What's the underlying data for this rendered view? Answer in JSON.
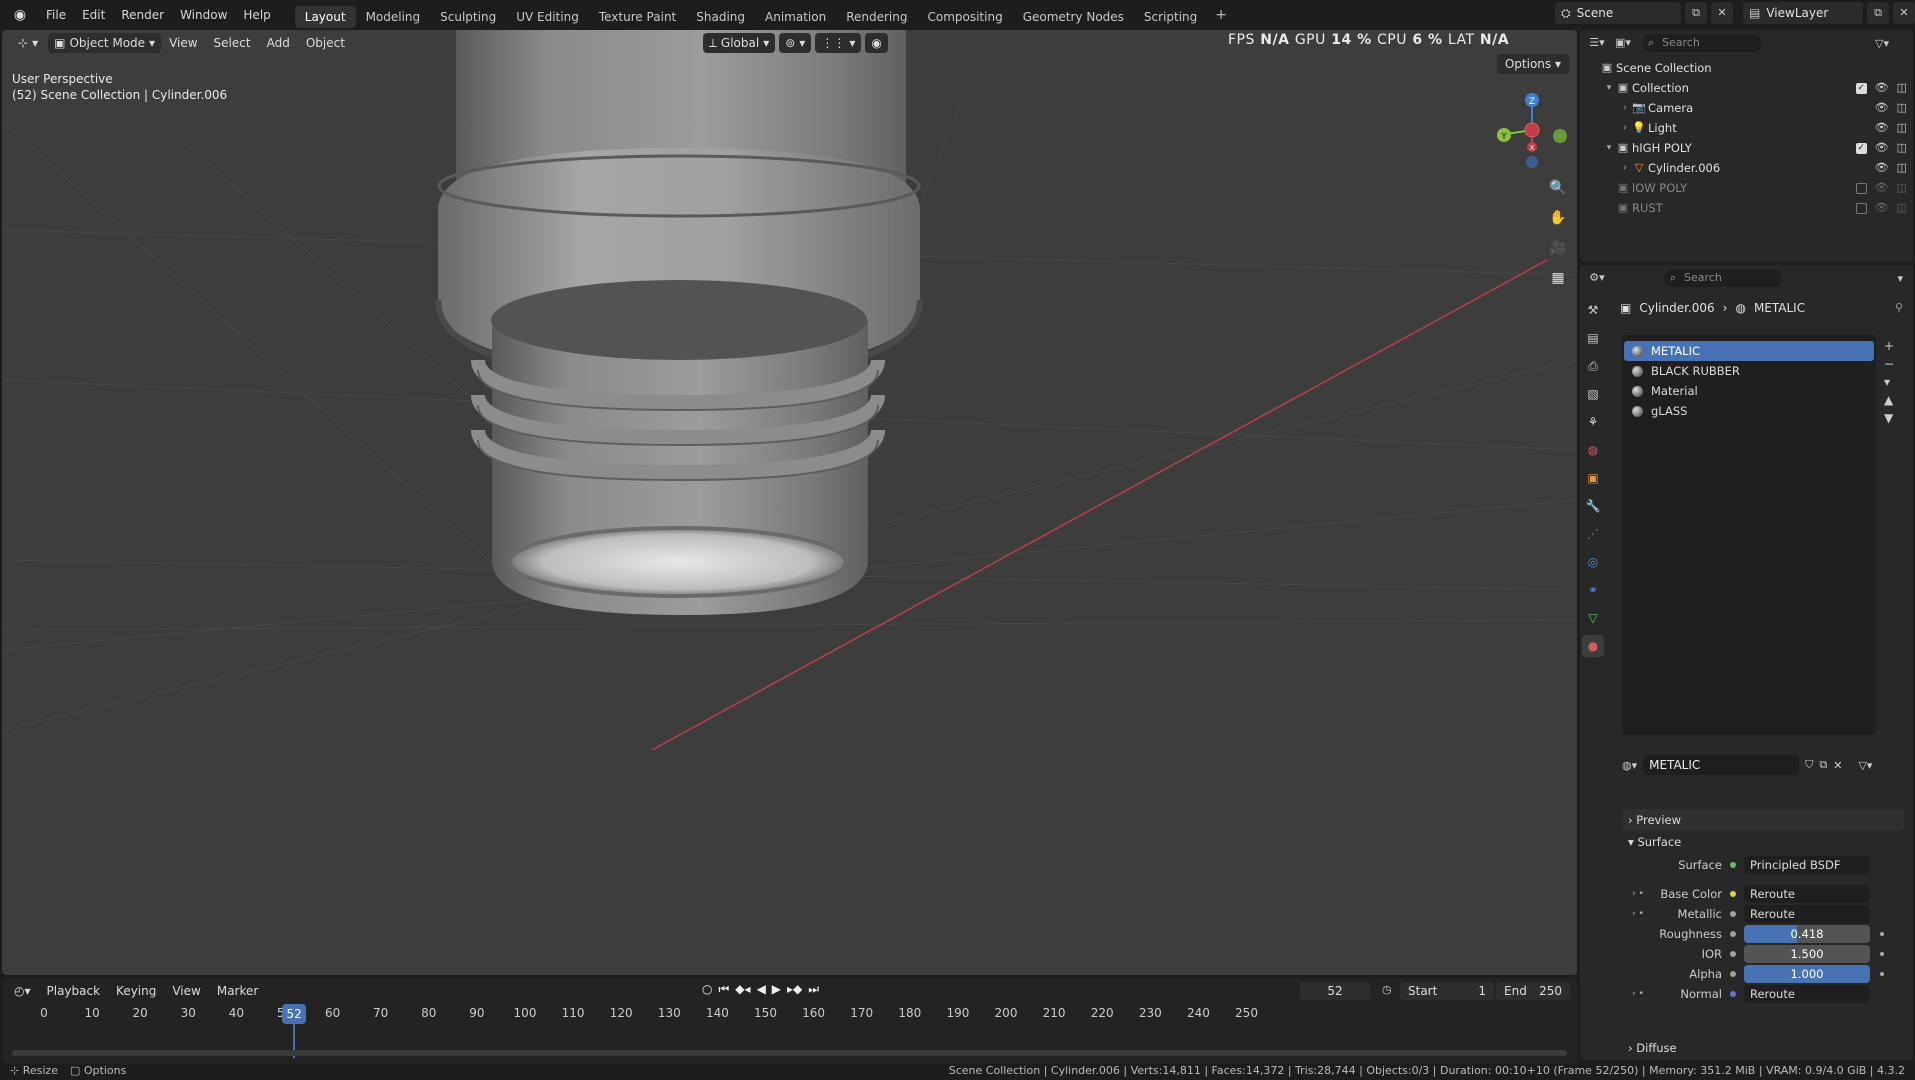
{
  "menu": [
    "File",
    "Edit",
    "Render",
    "Window",
    "Help"
  ],
  "workspaces": {
    "active": "Layout",
    "tabs": [
      "Layout",
      "Modeling",
      "Sculpting",
      "UV Editing",
      "Texture Paint",
      "Shading",
      "Animation",
      "Rendering",
      "Compositing",
      "Geometry Nodes",
      "Scripting"
    ]
  },
  "scene": "Scene",
  "view_layer": "ViewLayer",
  "search_placeholder": "Search",
  "viewport": {
    "mode": "Object Mode",
    "menus": [
      "View",
      "Select",
      "Add",
      "Object"
    ],
    "transform_orientation": "Global",
    "perspective_label": "User Perspective",
    "context_label": "(52) Scene Collection | Cylinder.006",
    "stats": {
      "fps_label": "FPS",
      "fps": "N/A",
      "gpu_label": "GPU",
      "gpu": "14 %",
      "cpu_label": "CPU",
      "cpu": "6 %",
      "lat_label": "LAT",
      "lat": "N/A"
    },
    "options": "Options",
    "gizmo": {
      "x": "X",
      "y": "Y",
      "z": "Z"
    },
    "colors": {
      "background": "#3d3d3d",
      "x_axis": "#c43c4a",
      "y_axis": "#88c240",
      "z_axis": "#3f7fd1"
    }
  },
  "timeline": {
    "menus": [
      "Playback",
      "Keying",
      "View",
      "Marker"
    ],
    "current_frame": "52",
    "start_label": "Start",
    "start": "1",
    "end_label": "End",
    "end": "250",
    "ticks": [
      "0",
      "10",
      "20",
      "30",
      "40",
      "50",
      "60",
      "70",
      "80",
      "90",
      "100",
      "110",
      "120",
      "130",
      "140",
      "150",
      "160",
      "170",
      "180",
      "190",
      "200",
      "210",
      "220",
      "230",
      "240",
      "250"
    ]
  },
  "statusbar": {
    "resize": "Resize",
    "options": "Options",
    "info": "Scene Collection | Cylinder.006 | Verts:14,811 | Faces:14,372 | Tris:28,744 | Objects:0/3 | Duration: 00:10+10 (Frame 52/250) | Memory: 351.2 MiB | VRAM: 0.9/4.0 GiB | 4.3.2"
  },
  "outliner": {
    "rows": [
      {
        "label": "Scene Collection",
        "indent": 0,
        "icon": "scene-collection-icon",
        "arrow": "",
        "dim": false,
        "right": ""
      },
      {
        "label": "Collection",
        "indent": 1,
        "icon": "collection-icon",
        "arrow": "▾",
        "dim": false,
        "right": "check"
      },
      {
        "label": "Camera",
        "indent": 2,
        "icon": "camera-icon",
        "arrow": "›",
        "dim": false,
        "right": "vis"
      },
      {
        "label": "Light",
        "indent": 2,
        "icon": "light-icon",
        "arrow": "›",
        "dim": false,
        "right": "vis"
      },
      {
        "label": "hIGH POLY",
        "indent": 1,
        "icon": "collection-icon",
        "arrow": "▾",
        "dim": false,
        "right": "check"
      },
      {
        "label": "Cylinder.006",
        "indent": 2,
        "icon": "mesh-object-icon",
        "arrow": "›",
        "dim": false,
        "right": "vis"
      },
      {
        "label": "lOW POLY",
        "indent": 1,
        "icon": "collection-icon",
        "arrow": "",
        "dim": true,
        "right": "off"
      },
      {
        "label": "RUST",
        "indent": 1,
        "icon": "collection-icon",
        "arrow": "",
        "dim": true,
        "right": "off"
      }
    ]
  },
  "properties": {
    "breadcrumb_object": "Cylinder.006",
    "breadcrumb_material": "METALIC",
    "materials": [
      "METALIC",
      "BLACK RUBBER",
      "Material",
      "gLASS"
    ],
    "selected_material": "METALIC",
    "slot_name": "METALIC",
    "panels": {
      "preview": "Preview",
      "surface": "Surface",
      "diffuse": "Diffuse"
    },
    "surface_rows": [
      {
        "label": "Surface",
        "value": "Principled BSDF",
        "type": "link",
        "socket": "#62c15f"
      },
      {
        "label": "Base Color",
        "value": "Reroute",
        "type": "link",
        "socket": "#e3d04a",
        "expand": true
      },
      {
        "label": "Metallic",
        "value": "Reroute",
        "type": "link",
        "socket": "#a1a1a1",
        "expand": true
      },
      {
        "label": "Roughness",
        "value": "0.418",
        "type": "slider",
        "fill": 0.418,
        "socket": "#a1a1a1"
      },
      {
        "label": "IOR",
        "value": "1.500",
        "type": "slider",
        "fill": 0,
        "socket": "#a1a1a1"
      },
      {
        "label": "Alpha",
        "value": "1.000",
        "type": "slider",
        "fill": 1,
        "socket": "#a1a1a1"
      },
      {
        "label": "Normal",
        "value": "Reroute",
        "type": "link",
        "socket": "#6d6dd8",
        "expand": true
      }
    ]
  }
}
